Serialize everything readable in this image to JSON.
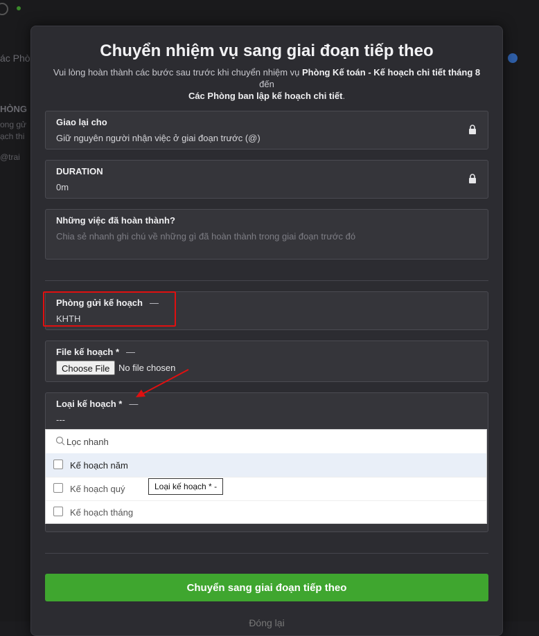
{
  "background": {
    "fragments": [
      "ác Phò",
      "HÒNG",
      "ong gử",
      "ạch thi",
      "@trai"
    ]
  },
  "modal": {
    "title": "Chuyển nhiệm vụ sang giai đoạn tiếp theo",
    "desc_prefix": "Vui lòng hoàn thành các bước sau trước khi chuyển nhiệm vụ ",
    "desc_task": "Phòng Kế toán - Kế hoạch chi tiết tháng 8",
    "desc_mid": " đến ",
    "desc_stage": "Các Phòng ban lập kế hoạch chi tiết",
    "desc_suffix": "."
  },
  "fields": {
    "assign": {
      "label": "Giao lại cho",
      "value": "Giữ nguyên người nhận việc ở giai đoạn trước (@)",
      "icon": "lock-icon"
    },
    "duration": {
      "label": "DURATION",
      "value": "0m",
      "icon": "lock-icon"
    },
    "done": {
      "label": "Những việc đã hoàn thành?",
      "placeholder": "Chia sẻ nhanh ghi chú về những gì đã hoàn thành trong giai đoạn trước đó"
    },
    "dept": {
      "label": "Phòng gửi kế hoạch",
      "dash": "—",
      "value": "KHTH"
    },
    "file": {
      "label": "File kế hoạch *",
      "dash": "—",
      "button": "Choose File",
      "status": "No file chosen"
    },
    "plan_type": {
      "label": "Loại kế hoạch *",
      "dash": "—",
      "value": "---"
    }
  },
  "dropdown": {
    "search_placeholder": "Lọc nhanh",
    "options": [
      {
        "label": "Kế hoạch năm",
        "active": true
      },
      {
        "label": "Kế hoạch quý",
        "active": false
      },
      {
        "label": "Kế hoạch tháng",
        "active": false
      }
    ]
  },
  "tooltip": "Loại kế hoạch * -",
  "actions": {
    "submit": "Chuyển sang giai đoạn tiếp theo",
    "close": "Đóng lại"
  },
  "colors": {
    "submit": "#3fa62f",
    "highlight": "#e01010",
    "modal_bg": "#2c2c31"
  }
}
